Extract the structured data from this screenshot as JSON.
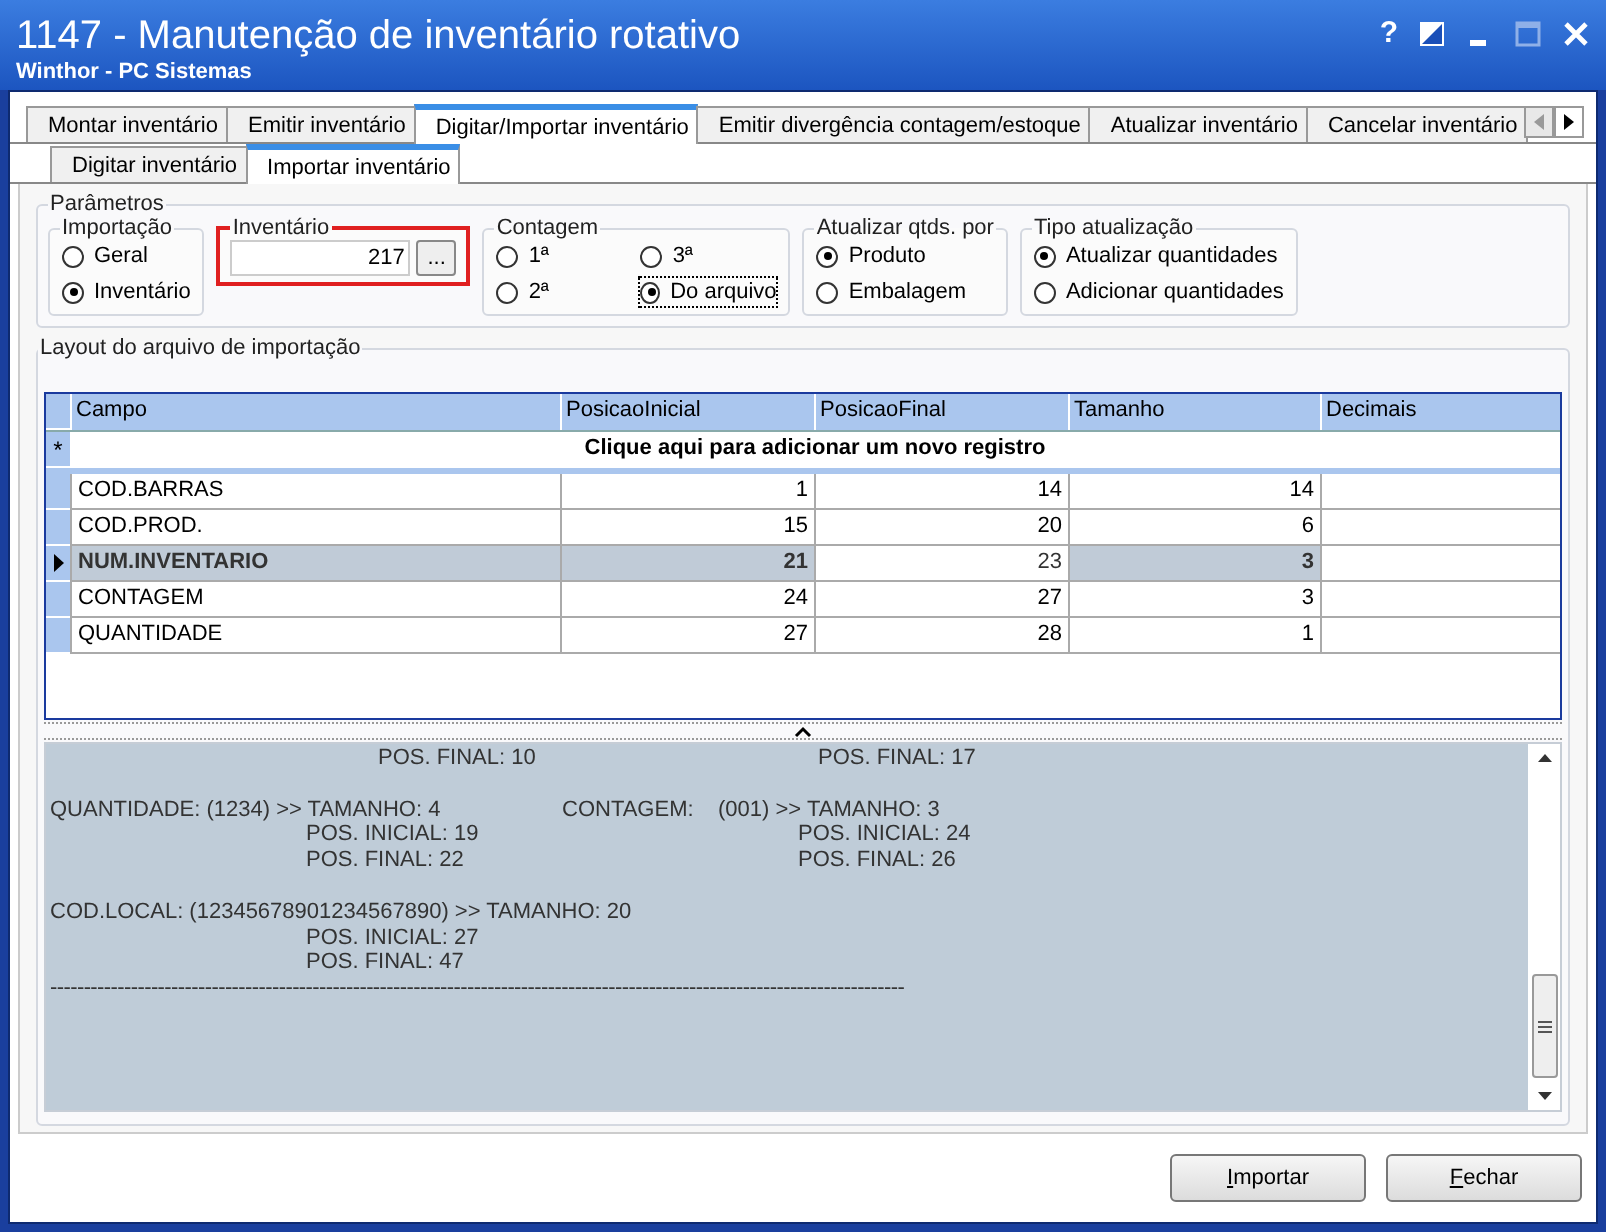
{
  "window": {
    "title": "1147 - Manutenção de inventário rotativo",
    "subtitle": "Winthor - PC Sistemas",
    "help": "?"
  },
  "tabs": [
    {
      "label": "Montar inventário",
      "selected": false
    },
    {
      "label": "Emitir inventário",
      "selected": false
    },
    {
      "label": "Digitar/Importar inventário",
      "selected": true
    },
    {
      "label": "Emitir divergência contagem/estoque",
      "selected": false
    },
    {
      "label": "Atualizar inventário",
      "selected": false
    },
    {
      "label": "Cancelar inventário",
      "selected": false
    }
  ],
  "subtabs": [
    {
      "label": "Digitar inventário",
      "selected": false
    },
    {
      "label": "Importar inventário",
      "selected": true
    }
  ],
  "parametros": {
    "title": "Parâmetros",
    "importacao": {
      "title": "Importação",
      "options": [
        {
          "label": "Geral",
          "selected": false
        },
        {
          "label": "Inventário",
          "selected": true
        }
      ]
    },
    "inventario": {
      "title": "Inventário",
      "value": "217",
      "button": "...",
      "highlighted": true
    },
    "contagem": {
      "title": "Contagem",
      "options": [
        {
          "label": "1ª",
          "selected": false,
          "focused": false
        },
        {
          "label": "3ª",
          "selected": false,
          "focused": false
        },
        {
          "label": "2ª",
          "selected": false,
          "focused": false
        },
        {
          "label": "Do arquivo",
          "selected": true,
          "focused": true
        }
      ]
    },
    "atualizar_por": {
      "title": "Atualizar qtds. por",
      "options": [
        {
          "label": "Produto",
          "selected": true
        },
        {
          "label": "Embalagem",
          "selected": false
        }
      ]
    },
    "tipo": {
      "title": "Tipo atualização",
      "options": [
        {
          "label": "Atualizar quantidades",
          "selected": true
        },
        {
          "label": "Adicionar quantidades",
          "selected": false
        }
      ]
    }
  },
  "layout": {
    "title": "Layout do arquivo de importação",
    "table": {
      "columns": [
        "Campo",
        "PosicaoInicial",
        "PosicaoFinal",
        "Tamanho",
        "Decimais"
      ],
      "new_row": "*",
      "new_row_text": "Clique aqui para adicionar um novo registro",
      "rows": [
        {
          "cells": [
            "COD.BARRAS",
            "1",
            "14",
            "14"
          ],
          "selected": false
        },
        {
          "cells": [
            "COD.PROD.",
            "15",
            "20",
            "6"
          ],
          "selected": false
        },
        {
          "cells": [
            "NUM.INVENTARIO",
            "21",
            "23",
            "3"
          ],
          "selected": true
        },
        {
          "cells": [
            "CONTAGEM",
            "24",
            "27",
            "3"
          ],
          "selected": false
        },
        {
          "cells": [
            "QUANTIDADE",
            "27",
            "28",
            "1"
          ],
          "selected": false
        }
      ]
    },
    "text_lines": [
      {
        "kind": "pos-shifted",
        "left": "POS. FINAL: 10",
        "right": "POS. FINAL: 17"
      },
      {
        "kind": "blank"
      },
      {
        "kind": "field",
        "left": "QUANTIDADE: (1234) >> TAMANHO: 4",
        "right": "CONTAGEM:    (001) >> TAMANHO: 3"
      },
      {
        "kind": "pos",
        "left": "POS. INICIAL: 19",
        "right": "POS. INICIAL: 24"
      },
      {
        "kind": "pos",
        "left": "POS. FINAL: 22",
        "right": "POS. FINAL: 26"
      },
      {
        "kind": "blank"
      },
      {
        "kind": "field",
        "left": "COD.LOCAL: (12345678901234567890) >> TAMANHO: 20"
      },
      {
        "kind": "pos",
        "left": "POS. INICIAL: 27"
      },
      {
        "kind": "pos",
        "left": "POS. FINAL: 47"
      },
      {
        "kind": "rule",
        "left": "-------------------------------------------------------------------------------------------------------------------------------"
      }
    ]
  },
  "buttons": [
    {
      "label": "Importar"
    },
    {
      "label": "Fechar"
    }
  ]
}
